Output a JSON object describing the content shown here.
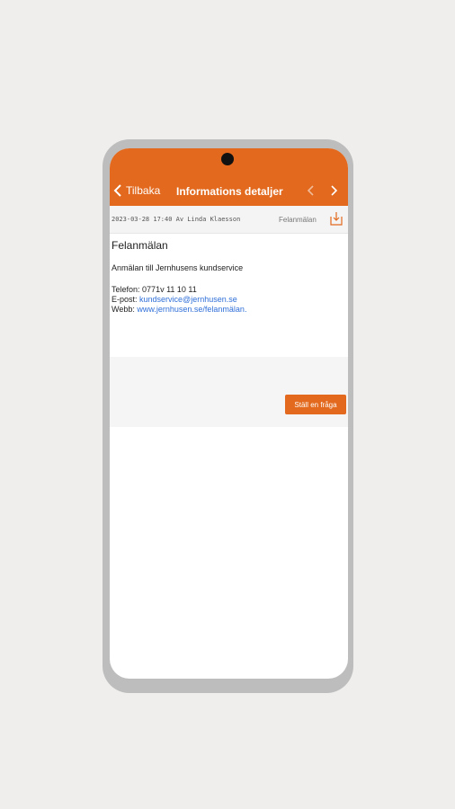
{
  "header": {
    "back_label": "Tilbaka",
    "title": "Informations detaljer"
  },
  "meta": {
    "date_author": "2023-03-28 17:40 Av Linda Klaesson",
    "category": "Felanmälan"
  },
  "article": {
    "title": "Felanmälan",
    "intro": "Anmälan till Jernhusens kundservice",
    "phone_label": "Telefon:",
    "phone_value": "0771v 11 10 11",
    "email_label": "E-post:",
    "email_value": "kundservice@jernhusen.se",
    "web_label": "Webb:",
    "web_value": "www.jernhusen.se/felanmälan."
  },
  "actions": {
    "ask_label": "Ställ en fråga"
  },
  "colors": {
    "accent": "#e2691d",
    "link": "#2f6fd8"
  },
  "icons": [
    "back-chevron-icon",
    "prev-arrow-icon",
    "next-arrow-icon",
    "download-icon"
  ]
}
